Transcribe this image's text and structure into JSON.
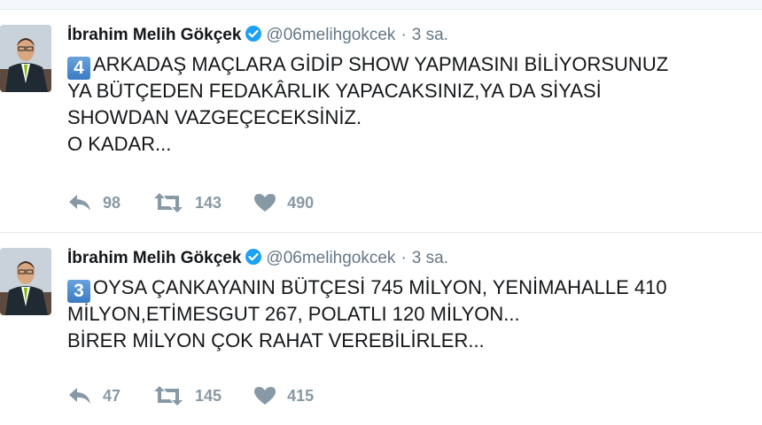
{
  "tweets": [
    {
      "author": {
        "name": "İbrahim Melih Gökçek",
        "handle": "@06melihgokcek",
        "verified": true
      },
      "time": "3 sa.",
      "badge": "4",
      "lines": [
        "ARKADAŞ MAÇLARA GİDİP SHOW YAPMASINI BİLİYORSUNUZ",
        "YA BÜTÇEDEN FEDAKÂRLIK YAPACAKSINIZ,YA DA SİYASİ",
        "SHOWDAN VAZGEÇECEKSİNİZ.",
        "O KADAR..."
      ],
      "stats": {
        "replies": "98",
        "retweets": "143",
        "likes": "490"
      }
    },
    {
      "author": {
        "name": "İbrahim Melih Gökçek",
        "handle": "@06melihgokcek",
        "verified": true
      },
      "time": "3 sa.",
      "badge": "3",
      "lines": [
        "OYSA ÇANKAYANIN BÜTÇESİ 745 MİLYON, YENİMAHALLE 410",
        "MİLYON,ETİMESGUT 267, POLATLI 120 MİLYON...",
        "BİRER MİLYON ÇOK RAHAT VEREBİLİRLER..."
      ],
      "stats": {
        "replies": "47",
        "retweets": "145",
        "likes": "415"
      }
    }
  ],
  "icons": {
    "reply": "reply-icon",
    "retweet": "retweet-icon",
    "like": "heart-icon",
    "verified": "verified-badge-icon"
  },
  "colors": {
    "verified": "#1da1f2",
    "muted": "#657786",
    "action": "#8899a6",
    "badge": "#3b7bc4"
  }
}
